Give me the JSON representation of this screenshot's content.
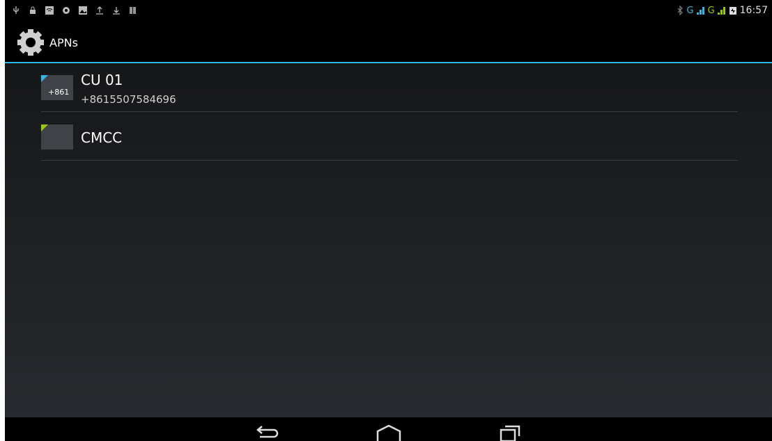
{
  "status_bar": {
    "left_icons": [
      "usb-icon",
      "lock-icon",
      "wifi-icon",
      "sync-icon",
      "image-icon",
      "upload-icon",
      "download-icon",
      "barcode-icon"
    ],
    "network_labels": [
      "G",
      "G"
    ],
    "time": "16:57"
  },
  "action_bar": {
    "icon": "settings-gear-icon",
    "title": "APNs"
  },
  "apn_list": [
    {
      "name": "CU 01",
      "number": "+8615507584696",
      "thumb_text": "+861",
      "flag_color": "#33b5e5"
    },
    {
      "name": "CMCC",
      "number": "",
      "thumb_text": "",
      "flag_color": "#99cc00"
    }
  ],
  "nav_bar": {
    "buttons": [
      "back-icon",
      "home-icon",
      "recent-apps-icon"
    ]
  },
  "colors": {
    "accent": "#33b5e5",
    "green": "#99cc00"
  }
}
